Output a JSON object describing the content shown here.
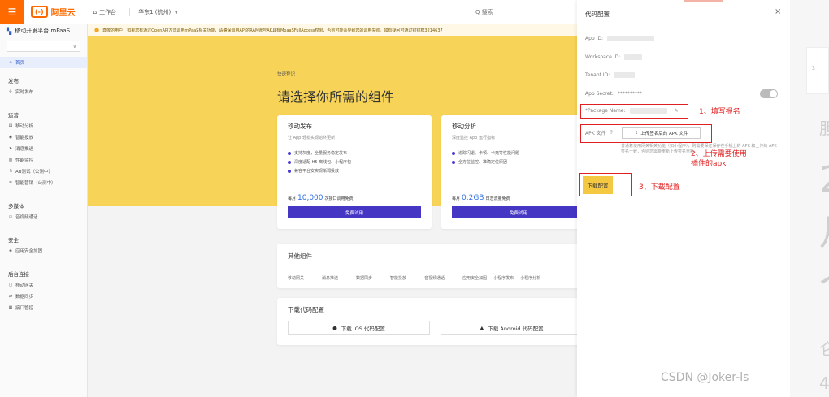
{
  "topbar": {
    "logo_text": "阿里云",
    "logo_mark": "(-)",
    "workbench": "工作台",
    "region": "华东1 (杭州)",
    "search_label": "Q 搜索"
  },
  "sidebar": {
    "platform": "移动开发平台 mPaaS",
    "select_caret": "∨",
    "home": "首页",
    "groups": {
      "publish": "发布",
      "ops": "运营",
      "media": "多媒体",
      "security": "安全",
      "backend": "后台连接"
    },
    "publish_items": [
      "实时发布"
    ],
    "ops_items": [
      "移动分析",
      "智能投放",
      "消息推送",
      "性能监控",
      "AB测试（公测中）",
      "智能营销（公测中）"
    ],
    "media_items": [
      "音视频通话"
    ],
    "security_items": [
      "应用安全加固"
    ],
    "backend_items": [
      "移动网关",
      "数据同步",
      "接口管控"
    ]
  },
  "notice": {
    "text": "尊敬的用户，如果您有通过OpenAPI方式调用mPaaS相关功能，请确保调用API的RAM账号AK具有MpaaSFullAccess权限，否则可能会导致您的调用失败。如有疑问可通过钉钉群3214637"
  },
  "hero": {
    "breadcrumb": "快速登记",
    "title": "请选择你所需的组件"
  },
  "cards": [
    {
      "title": "移动发布",
      "subtitle": "让 App 轻松实现始终更新",
      "features": [
        "支持灰度，全量服务稳定发布",
        "深度适配 H5 离线包、小程序包",
        "兼容平台安实现渐弱投放"
      ],
      "quota_prefix": "每月",
      "quota_num": "10,000",
      "quota_suffix": "次接口调用免费",
      "button": "免费试用"
    },
    {
      "title": "移动分析",
      "subtitle": "深度监控 App 运行指标",
      "features": [
        "追踪闪退、卡顿、卡死等性能问题",
        "全方位监控、准确定位原因"
      ],
      "quota_prefix": "每月",
      "quota_num": "0.2GB",
      "quota_suffix": "日志流量免费",
      "button": "免费试用"
    }
  ],
  "others": {
    "title": "其他组件",
    "items": [
      "移动网关",
      "消息推送",
      "数据同步",
      "智能投放",
      "音视频通话",
      "应用安全加固",
      "小程序发布",
      "小程序分析"
    ]
  },
  "download": {
    "title": "下载代码配置",
    "ios": "下载 iOS 代码配置",
    "android": "下载 Android 代码配置"
  },
  "drawer": {
    "title": "代码配置",
    "close": "×",
    "app_id_label": "App ID:",
    "workspace_label": "Workspace ID:",
    "tenant_label": "Tenant ID:",
    "secret_label": "App Secret:",
    "secret_value": "**********",
    "package_label": "*Package Name:",
    "apk_label": "APK 文件",
    "upload_button": "上传签名后的 APK 文件",
    "hint": "普通着使用网关相关功能（如小程序），则需要保证保存在手机上的 APK 和上传的 APK 签名一致，否则您需要重新上传签名重新。",
    "download_button": "下载配置"
  },
  "annotations": {
    "step1": "1、填写报名",
    "step2_line1": "2、上传需要使用",
    "step2_line2": "插件的apk",
    "step3": "3、下载配置"
  },
  "watermark": "CSDN @Joker-ls",
  "rightbg": {
    "small_digit": "3",
    "glyphs": [
      "胆",
      "2",
      "月",
      "个",
      "仑",
      "4"
    ]
  },
  "colors": {
    "brand_orange": "#ff6a00",
    "hero_yellow": "#f7d357",
    "primary_purple": "#4636c4",
    "annotation_red": "#e02020",
    "download_yellow": "#f5c842"
  }
}
